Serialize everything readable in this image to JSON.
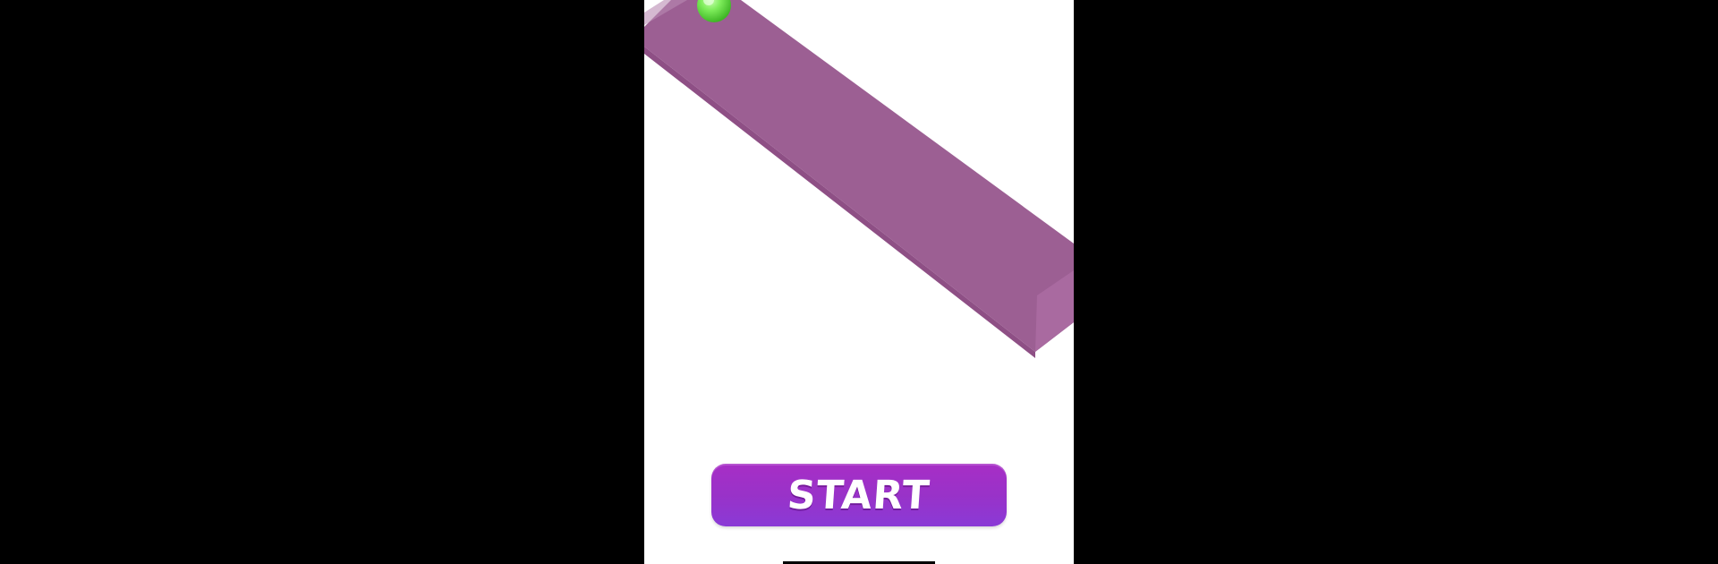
{
  "game": {
    "start_label": "START",
    "colors": {
      "background": "#000000",
      "playfield": "#ffffff",
      "track_top": "#9c5f93",
      "track_side": "#8e4f85",
      "track_end": "#a96aa0",
      "ball": "#7dec5a",
      "button": "#9932c8",
      "button_text": "#ffffff"
    }
  }
}
